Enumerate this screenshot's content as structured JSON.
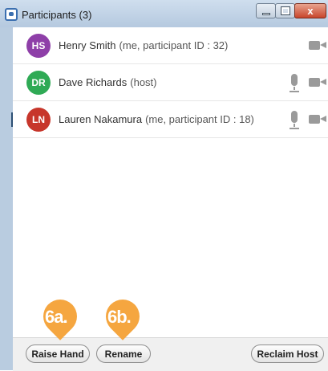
{
  "window": {
    "title": "Participants (3)",
    "close_glyph": "x"
  },
  "participants": [
    {
      "initials": "HS",
      "name": "Henry Smith",
      "detail": "(me, participant ID : 32)",
      "avatar_color": "#8e3fa8",
      "mic_visible": false,
      "camera_visible": true
    },
    {
      "initials": "DR",
      "name": "Dave Richards",
      "detail": "(host)",
      "avatar_color": "#2faa55",
      "mic_visible": true,
      "camera_visible": true
    },
    {
      "initials": "LN",
      "name": "Lauren Nakamura",
      "detail": "(me, participant ID : 18)",
      "avatar_color": "#c7362b",
      "mic_visible": true,
      "camera_visible": true
    }
  ],
  "footer": {
    "raise_hand_label": "Raise Hand",
    "rename_label": "Rename",
    "reclaim_host_label": "Reclaim Host"
  },
  "callouts": {
    "a": "6a.",
    "b": "6b."
  },
  "colors": {
    "callout": "#f5a640",
    "titlebar": "#b5c9df"
  }
}
